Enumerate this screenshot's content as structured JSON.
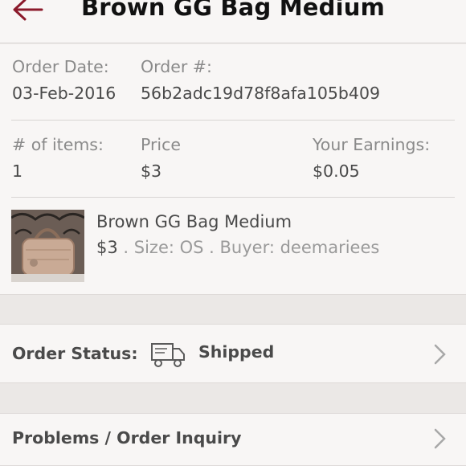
{
  "header": {
    "title": "Brown GG Bag Medium",
    "back_icon": "back-arrow-icon",
    "accent": "#8b1a2b"
  },
  "order": {
    "date_label": "Order Date:",
    "date_value": "03-Feb-2016",
    "number_label": "Order #:",
    "number_value": "56b2adc19d78f8afa105b409",
    "items_label": "# of items:",
    "items_value": "1",
    "price_label": "Price",
    "price_value": "$3",
    "earnings_label": "Your Earnings:",
    "earnings_value": "$0.05"
  },
  "item": {
    "title": "Brown GG Bag Medium",
    "price": "$3",
    "details": " . Size: OS . Buyer: deemariees"
  },
  "status_row": {
    "label": "Order Status:",
    "icon": "delivery-truck-icon",
    "value": "Shipped"
  },
  "inquiry_row": {
    "label": "Problems / Order Inquiry"
  }
}
